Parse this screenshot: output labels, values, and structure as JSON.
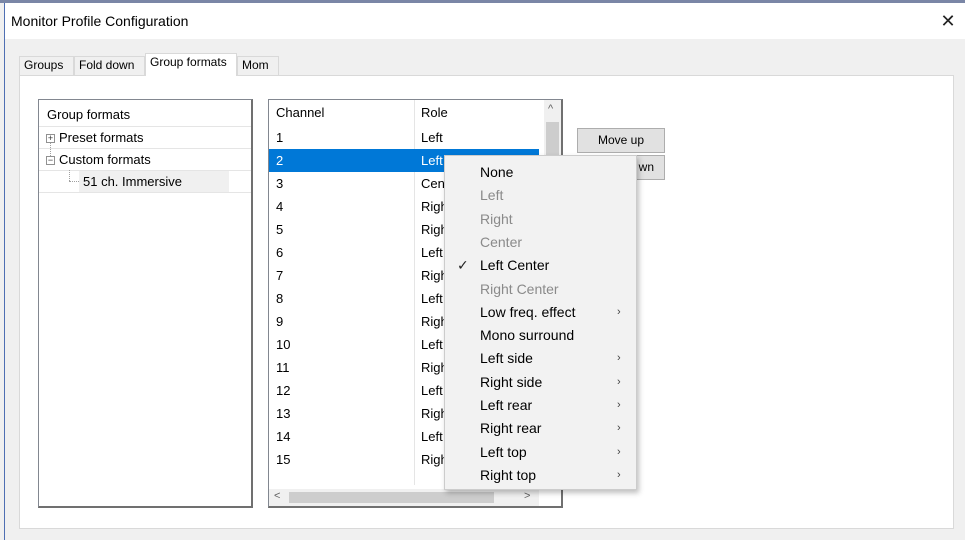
{
  "window": {
    "title": "Monitor Profile Configuration",
    "close_glyph": "✕"
  },
  "tabs": [
    {
      "label": "Groups"
    },
    {
      "label": "Fold down"
    },
    {
      "label": "Group formats",
      "active": true
    },
    {
      "label": "Mom"
    }
  ],
  "tree": {
    "header": "Group formats",
    "items": [
      {
        "label": "Preset formats",
        "expander": "+"
      },
      {
        "label": "Custom formats",
        "expander": "−"
      },
      {
        "label": "51 ch. Immersive"
      }
    ]
  },
  "list": {
    "columns": [
      "Channel",
      "Role"
    ],
    "rows": [
      {
        "channel": "1",
        "role": "Left"
      },
      {
        "channel": "2",
        "role": "Left Center",
        "selected": true
      },
      {
        "channel": "3",
        "role": "Cen"
      },
      {
        "channel": "4",
        "role": "Righ"
      },
      {
        "channel": "5",
        "role": "Righ"
      },
      {
        "channel": "6",
        "role": "Left"
      },
      {
        "channel": "7",
        "role": "Righ"
      },
      {
        "channel": "8",
        "role": "Left"
      },
      {
        "channel": "9",
        "role": "Righ"
      },
      {
        "channel": "10",
        "role": "Left"
      },
      {
        "channel": "11",
        "role": "Righ"
      },
      {
        "channel": "12",
        "role": "Left"
      },
      {
        "channel": "13",
        "role": "Righ"
      },
      {
        "channel": "14",
        "role": "Left"
      },
      {
        "channel": "15",
        "role": "Righ"
      }
    ],
    "scroll_up": "^",
    "scroll_left": "<",
    "scroll_right": ">"
  },
  "buttons": {
    "move_up": "Move up",
    "move_down": "wn"
  },
  "menu": {
    "items": [
      {
        "label": "None",
        "enabled": true
      },
      {
        "label": "Left",
        "enabled": false
      },
      {
        "label": "Right",
        "enabled": false
      },
      {
        "label": "Center",
        "enabled": false
      },
      {
        "label": "Left Center",
        "enabled": true,
        "checked": true
      },
      {
        "label": "Right Center",
        "enabled": false
      },
      {
        "label": "Low freq. effect",
        "enabled": true,
        "submenu": true
      },
      {
        "label": "Mono surround",
        "enabled": true
      },
      {
        "label": "Left side",
        "enabled": true,
        "submenu": true
      },
      {
        "label": "Right side",
        "enabled": true,
        "submenu": true
      },
      {
        "label": "Left rear",
        "enabled": true,
        "submenu": true
      },
      {
        "label": "Right rear",
        "enabled": true,
        "submenu": true
      },
      {
        "label": "Left top",
        "enabled": true,
        "submenu": true
      },
      {
        "label": "Right top",
        "enabled": true,
        "submenu": true
      }
    ],
    "check_glyph": "✓",
    "submenu_glyph": "›"
  }
}
